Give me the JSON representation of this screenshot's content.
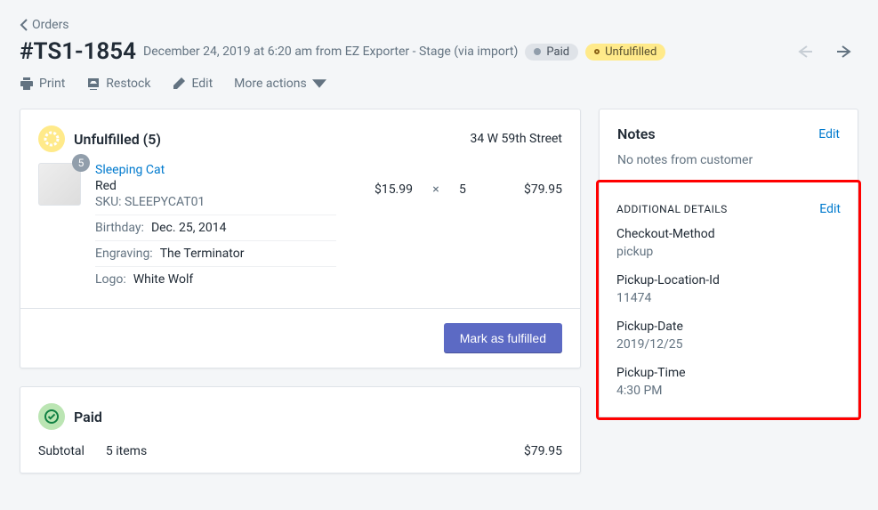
{
  "breadcrumb": {
    "label": "Orders"
  },
  "order": {
    "title": "#TS1-1854",
    "subtitle": "December 24, 2019 at 6:20 am from EZ Exporter - Stage (via import)",
    "paid_badge": "Paid",
    "unfulfilled_badge": "Unfulfilled"
  },
  "actions": {
    "print": "Print",
    "restock": "Restock",
    "edit": "Edit",
    "more": "More actions"
  },
  "fulfillment": {
    "title": "Unfulfilled (5)",
    "location": "34 W 59th Street",
    "line": {
      "qty_badge": "5",
      "name": "Sleeping Cat",
      "variant": "Red",
      "sku": "SKU: SLEEPYCAT01",
      "price": "$15.99",
      "mult": "×",
      "qty": "5",
      "total": "$79.95",
      "props": [
        {
          "key": "Birthday:",
          "val": "Dec. 25, 2014"
        },
        {
          "key": "Engraving:",
          "val": "The Terminator"
        },
        {
          "key": "Logo:",
          "val": "White Wolf"
        }
      ]
    },
    "button": "Mark as fulfilled"
  },
  "paid": {
    "title": "Paid",
    "subtotal_label": "Subtotal",
    "subtotal_items": "5 items",
    "subtotal_amount": "$79.95"
  },
  "notes": {
    "title": "Notes",
    "edit": "Edit",
    "empty": "No notes from customer"
  },
  "details": {
    "title": "Additional Details",
    "edit": "Edit",
    "items": [
      {
        "label": "Checkout-Method",
        "value": "pickup"
      },
      {
        "label": "Pickup-Location-Id",
        "value": "11474"
      },
      {
        "label": "Pickup-Date",
        "value": "2019/12/25"
      },
      {
        "label": "Pickup-Time",
        "value": "4:30 PM"
      }
    ]
  }
}
